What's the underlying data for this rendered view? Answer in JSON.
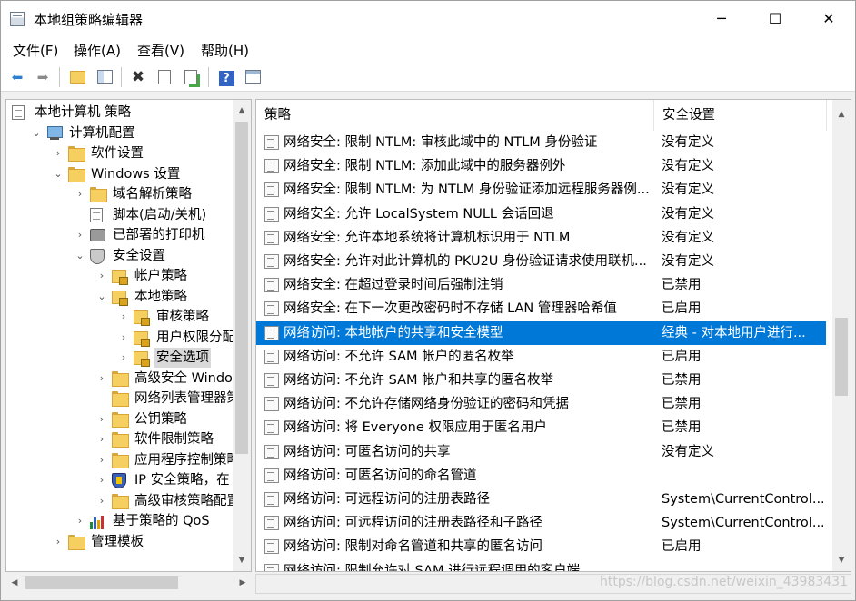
{
  "window": {
    "title": "本地组策略编辑器",
    "minimize": "─",
    "maximize": "☐",
    "close": "✕"
  },
  "menu": [
    "文件(F)",
    "操作(A)",
    "查看(V)",
    "帮助(H)"
  ],
  "toolbar": [
    "back-icon",
    "forward-icon",
    "up-folder-icon",
    "show-hide-tree-icon",
    "delete-icon",
    "properties-icon",
    "export-icon",
    "help-icon",
    "view-icon"
  ],
  "tree": [
    {
      "label": "本地计算机 策略",
      "icon": "document-icon"
    },
    {
      "label": "计算机配置",
      "icon": "computer-icon",
      "arrow": "⌄"
    },
    {
      "label": "软件设置",
      "icon": "folder-icon",
      "arrow": "›"
    },
    {
      "label": "Windows 设置",
      "icon": "folder-icon",
      "arrow": "⌄"
    },
    {
      "label": "域名解析策略",
      "icon": "folder-icon",
      "arrow": "›"
    },
    {
      "label": "脚本(启动/关机)",
      "icon": "script-icon"
    },
    {
      "label": "已部署的打印机",
      "icon": "printer-icon",
      "arrow": "›"
    },
    {
      "label": "安全设置",
      "icon": "shield-icon",
      "arrow": "⌄"
    },
    {
      "label": "帐户策略",
      "icon": "lock-folder-icon",
      "arrow": "›"
    },
    {
      "label": "本地策略",
      "icon": "lock-folder-icon",
      "arrow": "⌄"
    },
    {
      "label": "审核策略",
      "icon": "lock-folder-icon",
      "arrow": "›"
    },
    {
      "label": "用户权限分配",
      "icon": "lock-folder-icon",
      "arrow": "›"
    },
    {
      "label": "安全选项",
      "icon": "lock-folder-icon",
      "arrow": "›"
    },
    {
      "label": "高级安全 Windows",
      "icon": "folder-icon",
      "arrow": "›"
    },
    {
      "label": "网络列表管理器策",
      "icon": "folder-icon"
    },
    {
      "label": "公钥策略",
      "icon": "folder-icon",
      "arrow": "›"
    },
    {
      "label": "软件限制策略",
      "icon": "folder-icon",
      "arrow": "›"
    },
    {
      "label": "应用程序控制策略",
      "icon": "folder-icon",
      "arrow": "›"
    },
    {
      "label": "IP 安全策略，在 本",
      "icon": "ip-security-icon",
      "arrow": "›"
    },
    {
      "label": "高级审核策略配置",
      "icon": "folder-icon",
      "arrow": "›"
    },
    {
      "label": "基于策略的 QoS",
      "icon": "chart-bars-icon",
      "arrow": "›"
    },
    {
      "label": "管理模板",
      "icon": "folder-icon",
      "arrow": "›"
    }
  ],
  "list": {
    "headers": {
      "policy": "策略",
      "setting": "安全设置"
    },
    "rows": [
      {
        "policy": "网络安全: 限制 NTLM: 审核此域中的 NTLM 身份验证",
        "setting": "没有定义"
      },
      {
        "policy": "网络安全: 限制 NTLM: 添加此域中的服务器例外",
        "setting": "没有定义"
      },
      {
        "policy": "网络安全: 限制 NTLM: 为 NTLM 身份验证添加远程服务器例...",
        "setting": "没有定义"
      },
      {
        "policy": "网络安全: 允许 LocalSystem NULL 会话回退",
        "setting": "没有定义"
      },
      {
        "policy": "网络安全: 允许本地系统将计算机标识用于 NTLM",
        "setting": "没有定义"
      },
      {
        "policy": "网络安全: 允许对此计算机的 PKU2U 身份验证请求使用联机...",
        "setting": "没有定义"
      },
      {
        "policy": "网络安全: 在超过登录时间后强制注销",
        "setting": "已禁用"
      },
      {
        "policy": "网络安全: 在下一次更改密码时不存储 LAN 管理器哈希值",
        "setting": "已启用"
      },
      {
        "policy": "网络访问: 本地帐户的共享和安全模型",
        "setting": "经典 - 对本地用户进行..."
      },
      {
        "policy": "网络访问: 不允许 SAM 帐户的匿名枚举",
        "setting": "已启用"
      },
      {
        "policy": "网络访问: 不允许 SAM 帐户和共享的匿名枚举",
        "setting": "已禁用"
      },
      {
        "policy": "网络访问: 不允许存储网络身份验证的密码和凭据",
        "setting": "已禁用"
      },
      {
        "policy": "网络访问: 将 Everyone 权限应用于匿名用户",
        "setting": "已禁用"
      },
      {
        "policy": "网络访问: 可匿名访问的共享",
        "setting": "没有定义"
      },
      {
        "policy": "网络访问: 可匿名访问的命名管道",
        "setting": ""
      },
      {
        "policy": "网络访问: 可远程访问的注册表路径",
        "setting": "System\\CurrentControl..."
      },
      {
        "policy": "网络访问: 可远程访问的注册表路径和子路径",
        "setting": "System\\CurrentControl..."
      },
      {
        "policy": "网络访问: 限制对命名管道和共享的匿名访问",
        "setting": "已启用"
      },
      {
        "policy": "网络访问: 限制允许对 SAM 进行远程调用的客户端",
        "setting": ""
      }
    ]
  },
  "watermark": "https://blog.csdn.net/weixin_43983431",
  "colors": {
    "selection": "#0078d7",
    "folder": "#f6cf61"
  }
}
